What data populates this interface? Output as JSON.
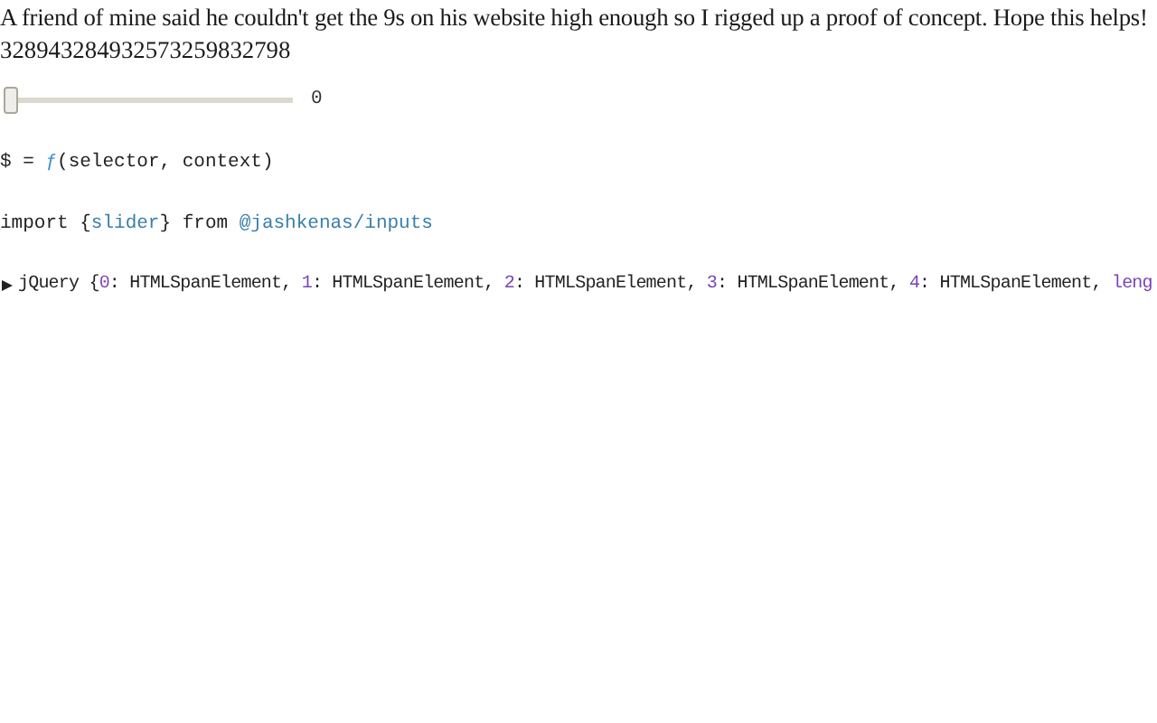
{
  "intro": {
    "text": "A friend of mine said he couldn't get the 9s on his website high enough so I rigged up a proof of concept. Hope this helps!",
    "number": "328943284932573259832798"
  },
  "slider": {
    "level": 0,
    "reading": "0"
  },
  "cells": [
    {
      "tokens": [
        {
          "text": "$ = ",
          "kind": "plain"
        },
        {
          "text": "ƒ",
          "kind": "fn"
        },
        {
          "text": "(selector, context)",
          "kind": "plain"
        }
      ]
    },
    {
      "tokens": [
        {
          "text": "import {",
          "kind": "plain"
        },
        {
          "text": "slider",
          "kind": "name"
        },
        {
          "text": "} from ",
          "kind": "plain"
        },
        {
          "text": "@jashkenas/inputs",
          "kind": "name"
        }
      ]
    }
  ],
  "output": {
    "expanded": false,
    "tokens": [
      {
        "text": "jQuery {",
        "kind": "plain"
      },
      {
        "text": "0",
        "kind": "num"
      },
      {
        "text": ": HTMLSpanElement, ",
        "kind": "plain"
      },
      {
        "text": "1",
        "kind": "num"
      },
      {
        "text": ": HTMLSpanElement, ",
        "kind": "plain"
      },
      {
        "text": "2",
        "kind": "num"
      },
      {
        "text": ": HTMLSpanElement, ",
        "kind": "plain"
      },
      {
        "text": "3",
        "kind": "num"
      },
      {
        "text": ": HTMLSpanElement, ",
        "kind": "plain"
      },
      {
        "text": "4",
        "kind": "num"
      },
      {
        "text": ": HTMLSpanElement, ",
        "kind": "plain"
      },
      {
        "text": "leng",
        "kind": "num"
      }
    ]
  }
}
